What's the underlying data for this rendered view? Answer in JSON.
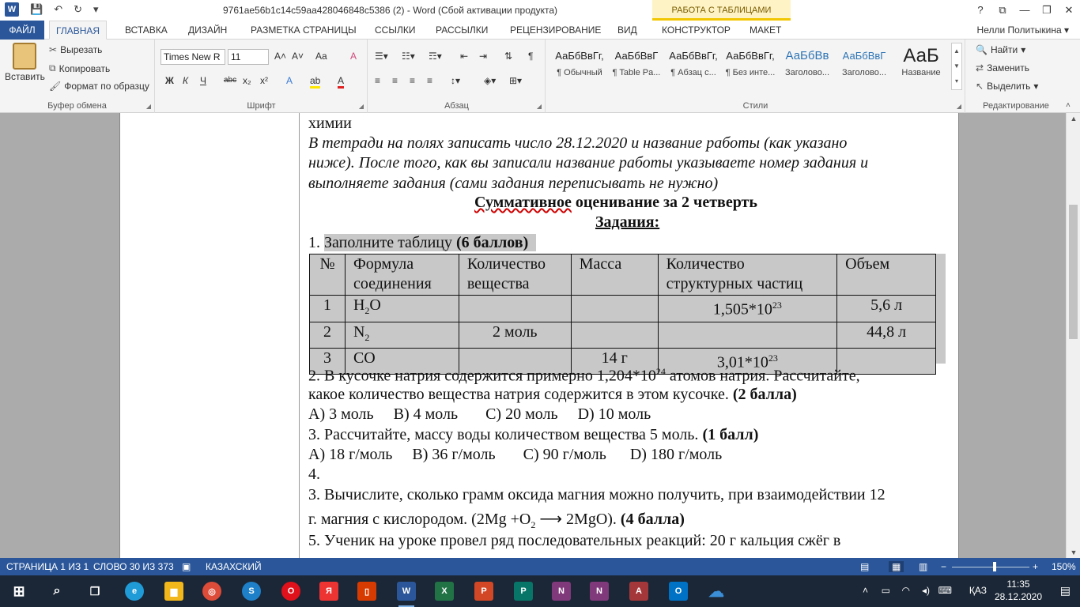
{
  "titlebar": {
    "title": "9761ae56b1c14c59aa428046848c5386 (2) - Word (Сбой активации продукта)",
    "context_tab": "РАБОТА С ТАБЛИЦАМИ",
    "qat": {
      "save": "💾",
      "undo": "↶",
      "redo": "↻",
      "customize": "▾"
    },
    "controls": {
      "help": "?",
      "restore_ribbon": "⧉",
      "minimize": "—",
      "maximize": "❐",
      "close": "✕"
    }
  },
  "tabs": {
    "file": "ФАЙЛ",
    "items": [
      "ГЛАВНАЯ",
      "ВСТАВКА",
      "ДИЗАЙН",
      "РАЗМЕТКА СТРАНИЦЫ",
      "ССЫЛКИ",
      "РАССЫЛКИ",
      "РЕЦЕНЗИРОВАНИЕ",
      "ВИД",
      "КОНСТРУКТОР",
      "МАКЕТ"
    ],
    "user": "Нелли Политыкина ▾"
  },
  "ribbon": {
    "clipboard": {
      "label": "Буфер обмена",
      "paste": "Вставить",
      "cut": "Вырезать",
      "copy": "Копировать",
      "format_painter": "Формат по образцу"
    },
    "font": {
      "label": "Шрифт",
      "font_name": "Times New R",
      "font_size": "11",
      "bold": "Ж",
      "italic": "К",
      "underline": "Ч",
      "strike": "abc",
      "sub": "x₂",
      "sup": "x²",
      "grow": "A˄",
      "shrink": "A˅",
      "case": "Aa",
      "clear": "A",
      "effects": "A",
      "highlight": "ab",
      "color": "A"
    },
    "paragraph": {
      "label": "Абзац"
    },
    "styles": {
      "label": "Стили",
      "items": [
        {
          "sample": "АаБбВвГг,",
          "name": "¶ Обычный"
        },
        {
          "sample": "АаБбВвГ",
          "name": "¶ Table Pa..."
        },
        {
          "sample": "АаБбВвГг,",
          "name": "¶ Абзац с..."
        },
        {
          "sample": "АаБбВвГг,",
          "name": "¶ Без инте..."
        },
        {
          "sample": "АаБбВв",
          "name": "Заголово..."
        },
        {
          "sample": "АаБбВвГ",
          "name": "Заголово..."
        },
        {
          "sample": "АаБ",
          "name": "Название"
        }
      ]
    },
    "editing": {
      "label": "Редактирование",
      "find": "Найти",
      "replace": "Заменить",
      "select": "Выделить"
    }
  },
  "document": {
    "l1": "химии",
    "l2": "В тетради на полях записать число 28.12.2020 и название работы (как указано",
    "l3": "ниже). После того, как вы записали название работы указываете номер задания и",
    "l4": "выполняете задания (сами задания переписывать не нужно)",
    "h1a": "Суммативное",
    "h1b": " оценивание за 2 четверть",
    "h2": "Задания:",
    "q1_num": "1. ",
    "q1_text": "Заполните таблицу ",
    "q1_points": "(6 баллов)",
    "table": {
      "headers": [
        "№",
        "Формула соединения",
        "Количество вещества",
        "Масса",
        "Количество структурных частиц",
        "Объем"
      ],
      "rows": [
        {
          "n": "1",
          "f1": "H",
          "fsub": "2",
          "f2": "O",
          "amount": "",
          "mass": "",
          "particles": "1,505*10",
          "psup": "23",
          "volume": "5,6 л"
        },
        {
          "n": "2",
          "f1": "N",
          "fsub": "2",
          "f2": "",
          "amount": "2 моль",
          "mass": "",
          "particles": "",
          "psup": "",
          "volume": "44,8 л"
        },
        {
          "n": "3",
          "f1": "CO",
          "fsub": "",
          "f2": "",
          "amount": "",
          "mass": "14 г",
          "particles": "3,01*10",
          "psup": "23",
          "volume": ""
        }
      ]
    },
    "q2a": "2. В кусочке натрия содержится примерно 1,204*10",
    "q2sup": "24",
    "q2b": " атомов натрия. Рассчитайте,",
    "q2c": "какое количество вещества натрия содержится в этом кусочке. ",
    "q2pts": "(2 балла)",
    "q2ans": "А) 3 моль     В) 4 моль       С) 20 моль     D) 10 моль",
    "q3": "3. Рассчитайте, массу воды количеством вещества 5 моль. ",
    "q3pts": "(1 балл)",
    "q3ans": "А) 18 г/моль     В) 36 г/моль       С) 90 г/моль      D) 180 г/моль",
    "q4": "4.",
    "q5a": "3. Вычислите, сколько грамм оксида магния можно получить, при взаимодействии 12",
    "q5b": "г. магния с кислородом. (2Mg +O",
    "q5sub": "2",
    "q5c": " ⟶ 2MgO). ",
    "q5pts": "(4 балла)",
    "q6": "5. Ученик на уроке провел ряд последовательных реакций: 20 г кальция сжёг в"
  },
  "status": {
    "page": "СТРАНИЦА 1 ИЗ 1",
    "words": "СЛОВО 30 ИЗ 373",
    "lang": "КАЗАХСКИЙ",
    "zoom": "150%"
  },
  "taskbar": {
    "lang": "ҚАЗ",
    "time": "11:35",
    "date": "28.12.2020"
  }
}
